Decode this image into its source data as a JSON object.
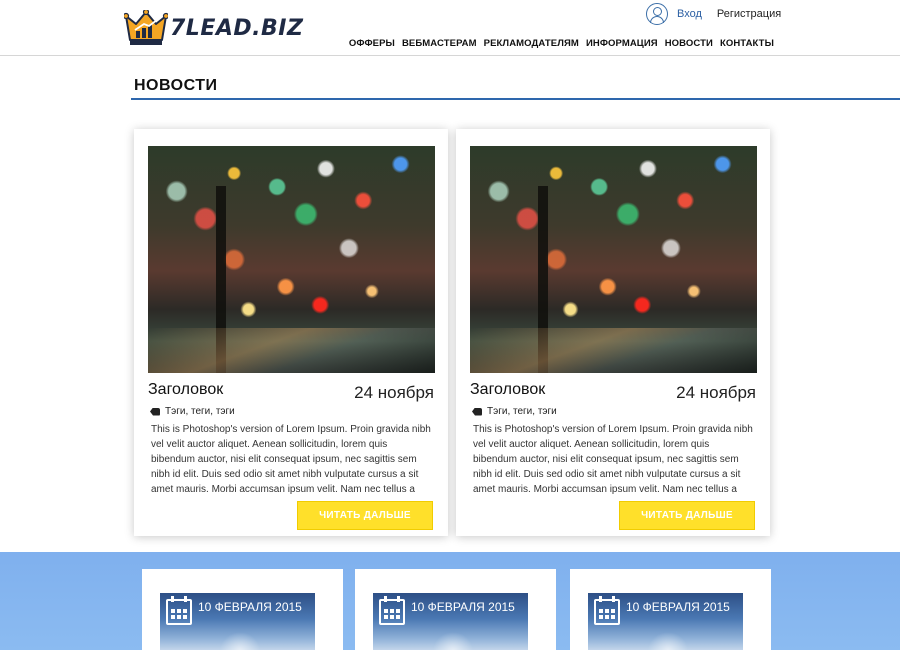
{
  "header": {
    "logo_text": "7LEAD.BIZ",
    "logo_icon": "crown-chart-icon",
    "auth": {
      "login_label": "Вход",
      "register_label": "Регистрация",
      "user_icon": "user-icon"
    },
    "nav": [
      "ОФФЕРЫ",
      "ВЕБМАСТЕРАМ",
      "РЕКЛАМОДАТЕЛЯМ",
      "ИНФОРМАЦИЯ",
      "НОВОСТИ",
      "КОНТАКТЫ"
    ]
  },
  "section": {
    "title": "НОВОСТИ",
    "accent_color": "#2e67ad"
  },
  "news": [
    {
      "title": "Заголовок",
      "date": "24 ноября",
      "tags": "Тэги, теги, тэги",
      "text": "This is Photoshop's version  of Lorem Ipsum. Proin gravida nibh vel velit auctor aliquet. Aenean sollicitudin, lorem quis bibendum auctor, nisi elit consequat ipsum, nec sagittis sem nibh id elit. Duis sed odio sit amet nibh vulputate cursus a sit amet mauris. Morbi accumsan ipsum velit. Nam nec tellus a",
      "button": "ЧИТАТЬ ДАЛЬШЕ"
    },
    {
      "title": "Заголовок",
      "date": "24 ноября",
      "tags": "Тэги, теги, тэги",
      "text": "This is Photoshop's version  of Lorem Ipsum. Proin gravida nibh vel velit auctor aliquet. Aenean sollicitudin, lorem quis bibendum auctor, nisi elit consequat ipsum, nec sagittis sem nibh id elit. Duis sed odio sit amet nibh vulputate cursus a sit amet mauris. Morbi accumsan ipsum velit. Nam nec tellus a",
      "button": "ЧИТАТЬ ДАЛЬШЕ"
    }
  ],
  "events": [
    {
      "date": "10 ФЕВРАЛЯ 2015"
    },
    {
      "date": "10 ФЕВРАЛЯ 2015"
    },
    {
      "date": "10 ФЕВРАЛЯ 2015"
    }
  ],
  "colors": {
    "button_yellow": "#ffe02a",
    "strip_blue": "#7fb0ee",
    "logo_navy": "#1f2a44",
    "logo_orange": "#f5a623"
  }
}
